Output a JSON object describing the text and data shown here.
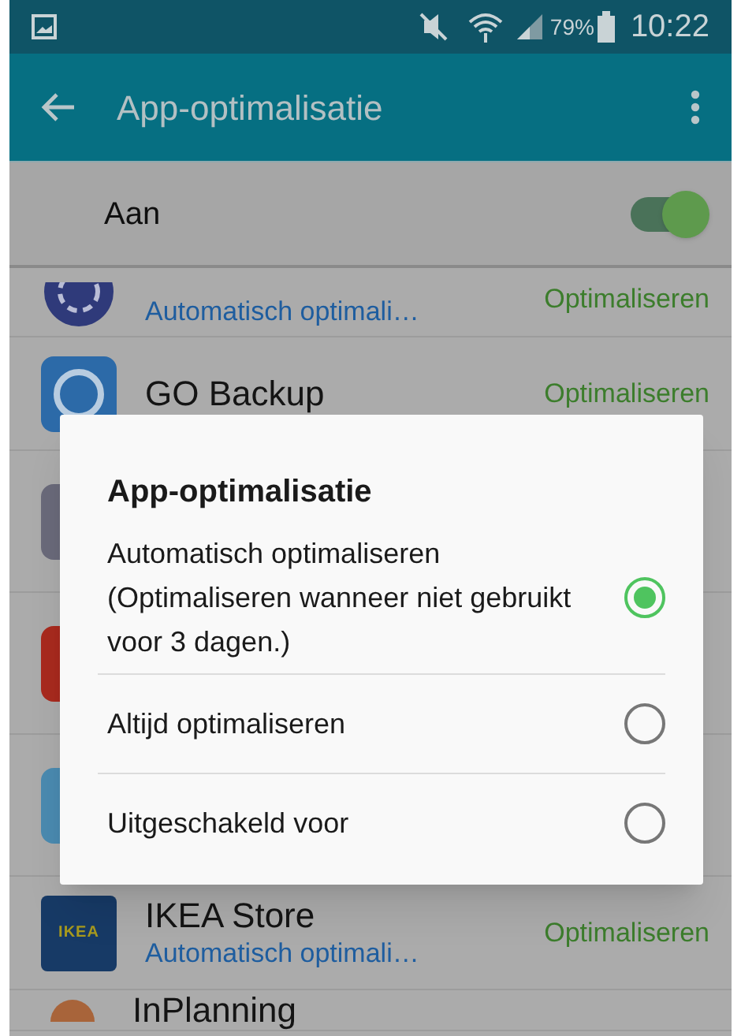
{
  "status_bar": {
    "battery": "79%",
    "time": "10:22"
  },
  "app_bar": {
    "title": "App-optimalisatie"
  },
  "master_switch": {
    "label": "Aan",
    "on": true
  },
  "apps": [
    {
      "kind": "partial",
      "status": "Optimaliseren",
      "subtitle": "Automatisch optimali…"
    },
    {
      "kind": "backup",
      "name": "GO Backup",
      "status": "Optimaliseren"
    },
    {
      "kind": "ikea",
      "name": "IKEA Store",
      "status": "Optimaliseren",
      "subtitle": "Automatisch optimali…",
      "logo_text": "IKEA"
    },
    {
      "kind": "planning",
      "name": "InPlanning"
    }
  ],
  "dialog": {
    "title": "App-optimalisatie",
    "options": [
      {
        "label": "Automatisch optimaliseren",
        "description": "(Optimaliseren wanneer niet gebruikt voor 3 dagen.)",
        "selected": true
      },
      {
        "label": "Altijd optimaliseren",
        "selected": false
      },
      {
        "label": "Uitgeschakeld voor",
        "selected": false
      }
    ]
  }
}
